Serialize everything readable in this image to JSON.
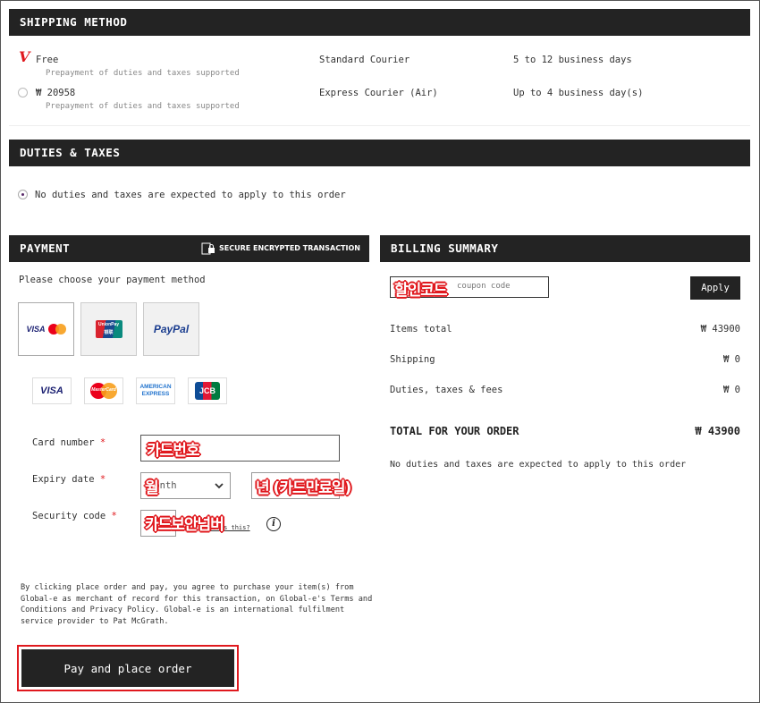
{
  "shipping": {
    "header": "SHIPPING METHOD",
    "options": [
      {
        "price": "Free",
        "note": "Prepayment of duties and taxes supported",
        "courier": "Standard Courier",
        "time": "5 to 12 business days",
        "selected_mark": "V"
      },
      {
        "price": "₩ 20958",
        "note": "Prepayment of duties and taxes supported",
        "courier": "Express Courier (Air)",
        "time": "Up to 4 business day(s)"
      }
    ]
  },
  "duties": {
    "header": "DUTIES & TAXES",
    "option": "No duties and taxes are expected to apply to this order"
  },
  "payment": {
    "header": "PAYMENT",
    "secure_label": "SECURE ENCRYPTED TRANSACTION",
    "choose_text": "Please choose your payment method",
    "methods": [
      {
        "name": "visa-mastercard",
        "label1": "VISA",
        "label2": "MasterCard"
      },
      {
        "name": "unionpay",
        "label1": "UnionPay",
        "label2": "银联"
      },
      {
        "name": "paypal",
        "label1": "PayPal"
      }
    ],
    "cards": [
      {
        "label": "VISA"
      },
      {
        "label": "MasterCard"
      },
      {
        "label": "AMERICAN",
        "label2": "EXPRESS"
      },
      {
        "label": "JCB"
      }
    ],
    "card_number_label": "Card number",
    "expiry_label": "Expiry date",
    "security_label": "Security code",
    "required_mark": "*",
    "card_number_annotation": "카드번호",
    "month_placeholder": "Month",
    "month_annotation": "월",
    "year_annotation": "년 (카드만료일)",
    "security_annotation": "카드보안넘버",
    "whats_this": "What's this?",
    "info_icon": "i",
    "legal_text_1": "By clicking place order and pay, you agree to purchase your item(s) from Global-e as merchant of record for this transaction, on Global-e's",
    "terms_link": "Terms and Conditions",
    "legal_and": "and",
    "privacy_link": "Privacy Policy",
    "legal_text_2": ". Global-e is an international fulfilment service provider to Pat McGrath.",
    "pay_button": "Pay and place order"
  },
  "billing": {
    "header": "BILLING SUMMARY",
    "coupon_annotation": "할인코드",
    "coupon_placeholder": "coupon code",
    "apply_button": "Apply",
    "rows": [
      {
        "label": "Items total",
        "value": "₩ 43900"
      },
      {
        "label": "Shipping",
        "value": "₩ 0"
      },
      {
        "label": "Duties, taxes & fees",
        "value": "₩ 0"
      }
    ],
    "total_label": "TOTAL FOR YOUR ORDER",
    "total_value": "₩ 43900",
    "note": "No duties and taxes are expected to apply to this order"
  },
  "colors": {
    "header_bg": "#232323",
    "accent_red": "#e0191e",
    "paypal_blue": "#1a3d8f",
    "visa_blue": "#1a1f71"
  }
}
